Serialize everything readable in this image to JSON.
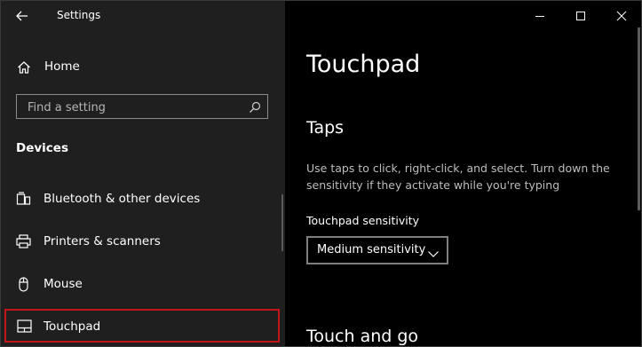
{
  "window": {
    "app_title": "Settings",
    "controls": [
      "minimize",
      "maximize",
      "close"
    ]
  },
  "sidebar": {
    "home_label": "Home",
    "search": {
      "placeholder": "Find a setting",
      "value": ""
    },
    "section_heading": "Devices",
    "items": [
      {
        "label": "Bluetooth & other devices",
        "icon": "bluetooth-icon",
        "selected": false
      },
      {
        "label": "Printers & scanners",
        "icon": "printer-icon",
        "selected": false
      },
      {
        "label": "Mouse",
        "icon": "mouse-icon",
        "selected": false
      },
      {
        "label": "Touchpad",
        "icon": "touchpad-icon",
        "selected": true
      }
    ]
  },
  "main": {
    "page_title": "Touchpad",
    "taps": {
      "title": "Taps",
      "description": "Use taps to click, right-click, and select. Turn down the sensitivity if they activate while you're typing",
      "sensitivity_label": "Touchpad sensitivity",
      "sensitivity_value": "Medium sensitivity"
    },
    "next_section_title": "Touch and go"
  },
  "colors": {
    "sidebar_bg": "#1f1f1f",
    "main_bg": "#000000",
    "highlight_border": "#c4141c",
    "secondary_text": "#bdbdbd"
  }
}
